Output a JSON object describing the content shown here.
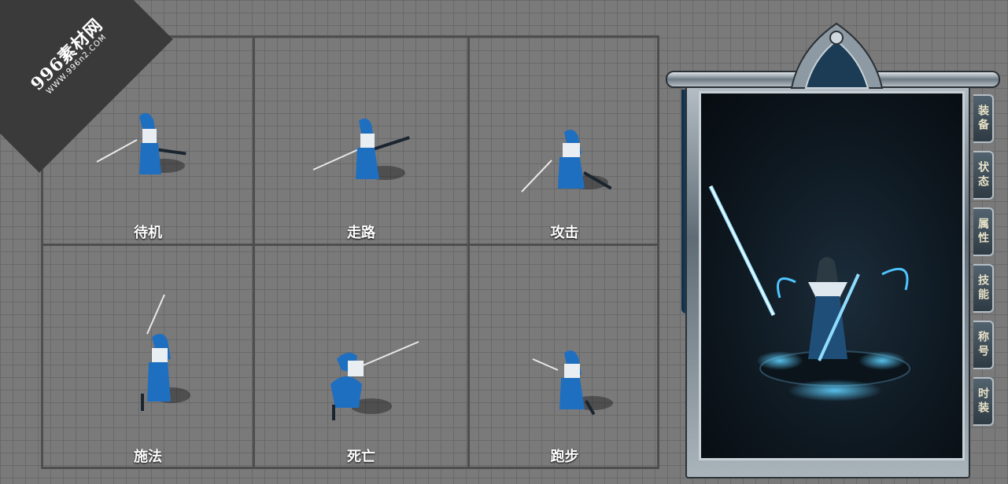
{
  "watermark": {
    "site_name": "996素材网",
    "url": "WWW.996n2.COM"
  },
  "actions": [
    {
      "id": "idle",
      "label": "待机"
    },
    {
      "id": "walk",
      "label": "走路"
    },
    {
      "id": "attack",
      "label": "攻击"
    },
    {
      "id": "cast",
      "label": "施法"
    },
    {
      "id": "death",
      "label": "死亡"
    },
    {
      "id": "run",
      "label": "跑步"
    }
  ],
  "panel": {
    "tabs": [
      "装备",
      "状态",
      "属性",
      "技能",
      "称号",
      "时装"
    ]
  },
  "colors": {
    "background": "#7b7a7a",
    "grid_line": "#4e4e4e",
    "character_blue": "#1f6fc0",
    "panel_dark": "#0e1820",
    "glow": "#5fd0ff"
  }
}
